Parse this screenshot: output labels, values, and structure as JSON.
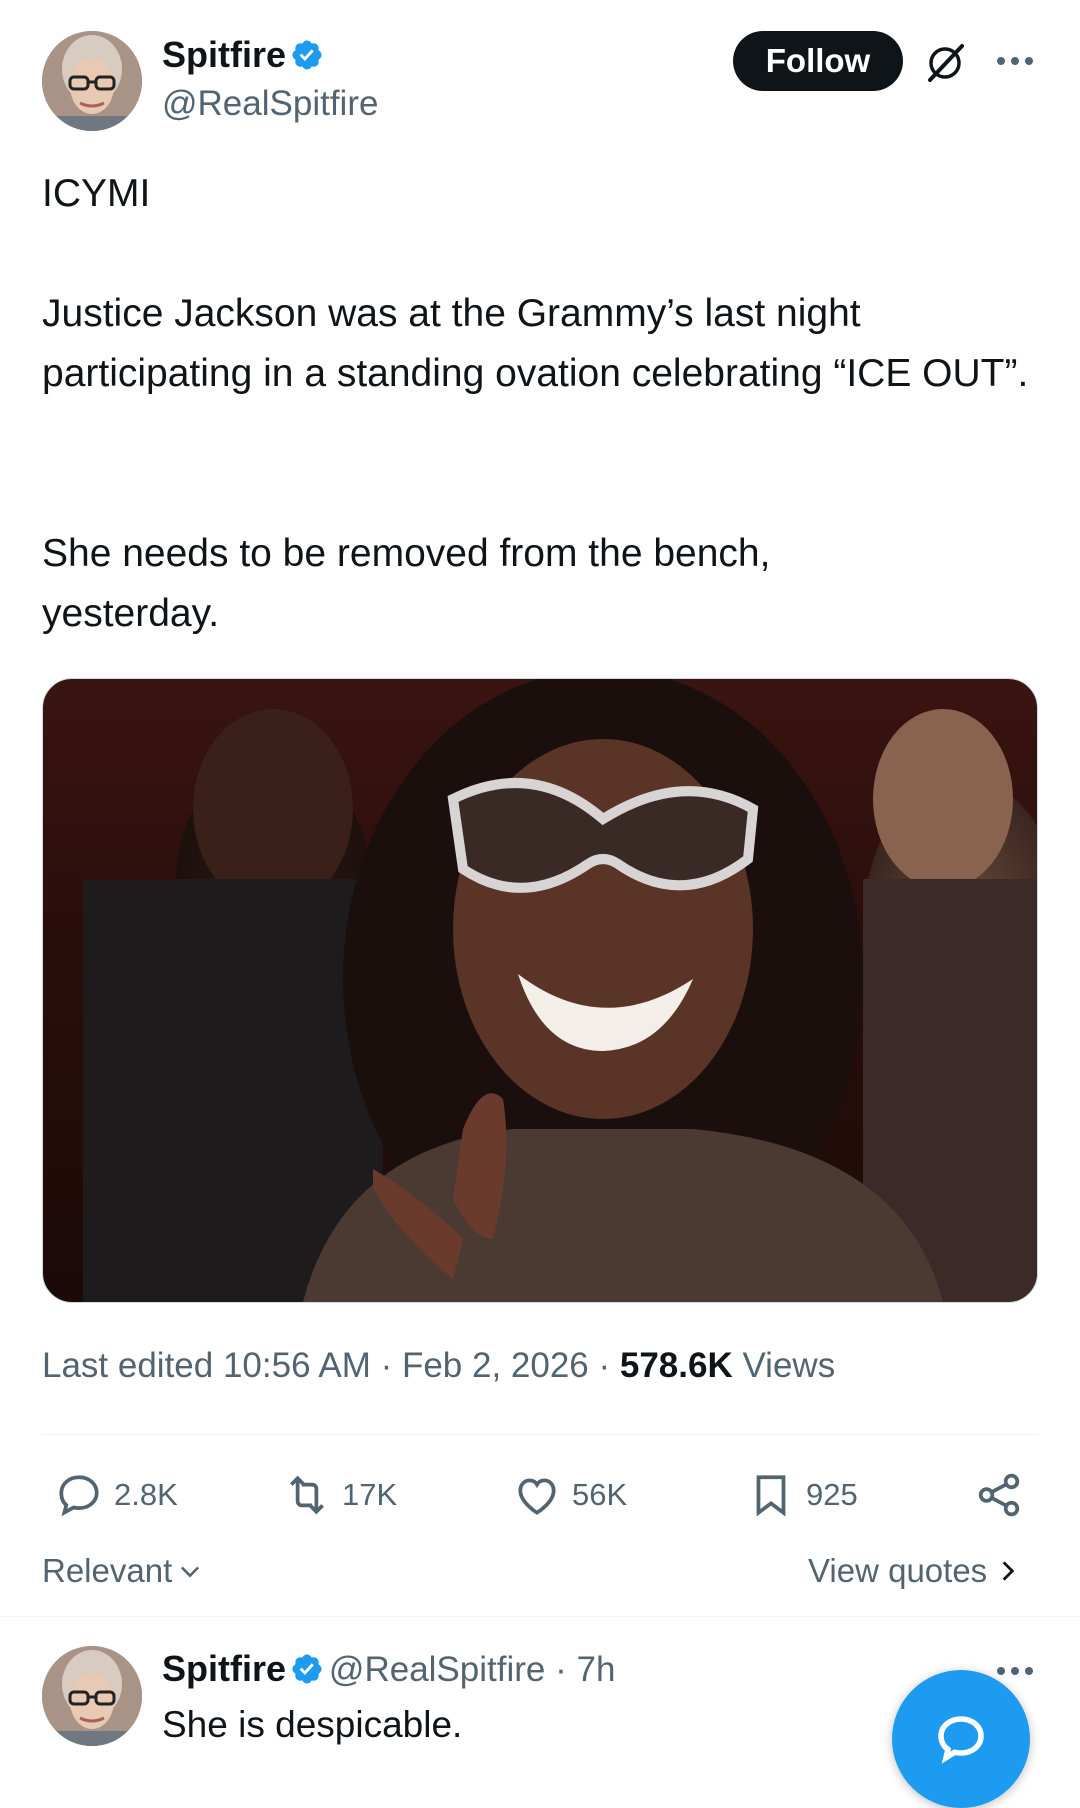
{
  "post": {
    "author": {
      "name": "Spitfire",
      "handle": "@RealSpitfire"
    },
    "follow_label": "Follow",
    "text_line1": "ICYMI",
    "text_para2": "Justice Jackson was at the Grammy’s last night participating in a standing ovation celebrating “ICE OUT”.",
    "text_para3": "She needs to be removed from the bench, yesterday.",
    "meta": {
      "edited": "Last edited 10:56 AM · Feb 2, 2026 · ",
      "views_count": "578.6K",
      "views_label": " Views"
    },
    "actions": {
      "replies": "2.8K",
      "reposts": "17K",
      "likes": "56K",
      "bookmarks": "925"
    },
    "sort_label": "Relevant",
    "view_quotes_label": "View quotes"
  },
  "reply": {
    "author": {
      "name": "Spitfire",
      "handle": "@RealSpitfire",
      "time": " · 7h"
    },
    "text": "She is despicable."
  },
  "icons": [
    "verified-badge-icon",
    "grok-icon",
    "more-icon",
    "reply-icon",
    "repost-icon",
    "like-icon",
    "bookmark-icon",
    "share-icon",
    "chevron-down-icon",
    "chevron-right-icon",
    "compose-reply-icon"
  ],
  "colors": {
    "accent": "#1d9bf0",
    "text": "#0f1419",
    "secondary": "#536471",
    "follow_bg": "#0f1419"
  }
}
